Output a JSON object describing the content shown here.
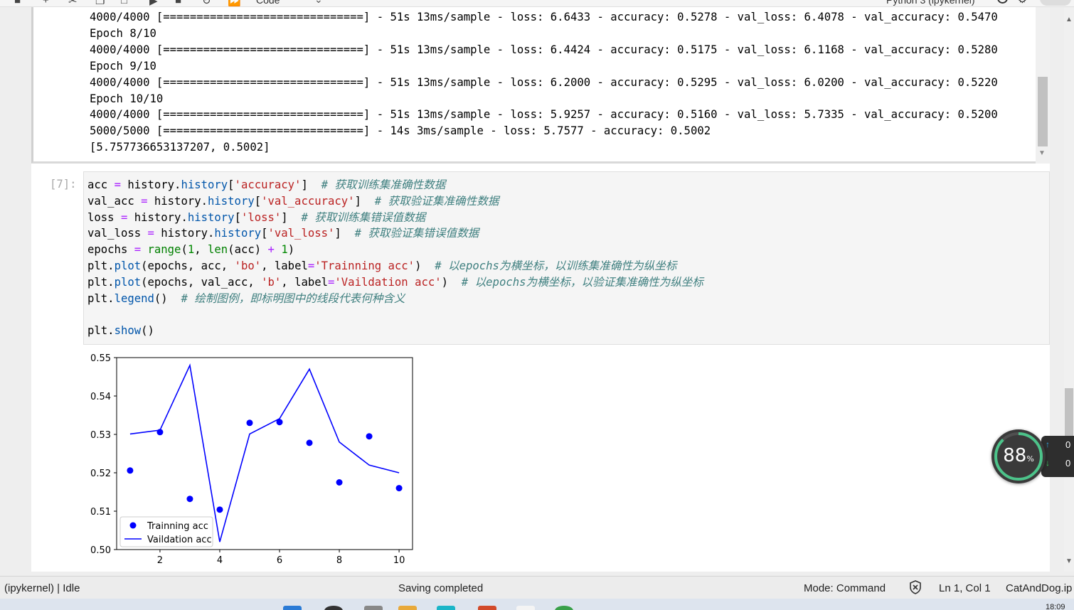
{
  "toolbar": {
    "cell_type": "Code",
    "kernel_name": "Python 3 (ipykernel)"
  },
  "output": {
    "lines": [
      "4000/4000 [==============================] - 51s 13ms/sample - loss: 6.6433 - accuracy: 0.5278 - val_loss: 6.4078 - val_accuracy: 0.5470",
      "Epoch 8/10",
      "4000/4000 [==============================] - 51s 13ms/sample - loss: 6.4424 - accuracy: 0.5175 - val_loss: 6.1168 - val_accuracy: 0.5280",
      "Epoch 9/10",
      "4000/4000 [==============================] - 51s 13ms/sample - loss: 6.2000 - accuracy: 0.5295 - val_loss: 6.0200 - val_accuracy: 0.5220",
      "Epoch 10/10",
      "4000/4000 [==============================] - 51s 13ms/sample - loss: 5.9257 - accuracy: 0.5160 - val_loss: 5.7335 - val_accuracy: 0.5200",
      "5000/5000 [==============================] - 14s 3ms/sample - loss: 5.7577 - accuracy: 0.5002",
      "[5.757736653137207, 0.5002]"
    ]
  },
  "cell": {
    "prompt": "[7]:",
    "code": [
      {
        "tokens": [
          [
            "acc ",
            ""
          ],
          [
            "=",
            "op"
          ],
          [
            " history.",
            ""
          ],
          [
            "history",
            "attr"
          ],
          [
            "[",
            ""
          ],
          [
            "'accuracy'",
            "str"
          ],
          [
            "]  ",
            ""
          ],
          [
            "# 获取训练集准确性数据",
            "com"
          ]
        ]
      },
      {
        "tokens": [
          [
            "val_acc ",
            ""
          ],
          [
            "=",
            "op"
          ],
          [
            " history.",
            ""
          ],
          [
            "history",
            "attr"
          ],
          [
            "[",
            ""
          ],
          [
            "'val_accuracy'",
            "str"
          ],
          [
            "]  ",
            ""
          ],
          [
            "# 获取验证集准确性数据",
            "com"
          ]
        ]
      },
      {
        "tokens": [
          [
            "loss ",
            ""
          ],
          [
            "=",
            "op"
          ],
          [
            " history.",
            ""
          ],
          [
            "history",
            "attr"
          ],
          [
            "[",
            ""
          ],
          [
            "'loss'",
            "str"
          ],
          [
            "]  ",
            ""
          ],
          [
            "# 获取训练集错误值数据",
            "com"
          ]
        ]
      },
      {
        "tokens": [
          [
            "val_loss ",
            ""
          ],
          [
            "=",
            "op"
          ],
          [
            " history.",
            ""
          ],
          [
            "history",
            "attr"
          ],
          [
            "[",
            ""
          ],
          [
            "'val_loss'",
            "str"
          ],
          [
            "]  ",
            ""
          ],
          [
            "# 获取验证集错误值数据",
            "com"
          ]
        ]
      },
      {
        "tokens": [
          [
            "epochs ",
            ""
          ],
          [
            "=",
            "op"
          ],
          [
            " ",
            ""
          ],
          [
            "range",
            "builtin"
          ],
          [
            "(",
            ""
          ],
          [
            "1",
            "num"
          ],
          [
            ", ",
            ""
          ],
          [
            "len",
            "builtin"
          ],
          [
            "(acc) ",
            ""
          ],
          [
            "+",
            "op"
          ],
          [
            " ",
            ""
          ],
          [
            "1",
            "num"
          ],
          [
            ")",
            ""
          ]
        ]
      },
      {
        "tokens": [
          [
            "plt.",
            ""
          ],
          [
            "plot",
            "attr"
          ],
          [
            "(epochs, acc, ",
            ""
          ],
          [
            "'bo'",
            "str"
          ],
          [
            ", label",
            ""
          ],
          [
            "=",
            "op"
          ],
          [
            "'Trainning acc'",
            "str"
          ],
          [
            ")  ",
            ""
          ],
          [
            "# 以epochs为横坐标，以训练集准确性为纵坐标",
            "com"
          ]
        ]
      },
      {
        "tokens": [
          [
            "plt.",
            ""
          ],
          [
            "plot",
            "attr"
          ],
          [
            "(epochs, val_acc, ",
            ""
          ],
          [
            "'b'",
            "str"
          ],
          [
            ", label",
            ""
          ],
          [
            "=",
            "op"
          ],
          [
            "'Vaildation acc'",
            "str"
          ],
          [
            ")  ",
            ""
          ],
          [
            "# 以epochs为横坐标，以验证集准确性为纵坐标",
            "com"
          ]
        ]
      },
      {
        "tokens": [
          [
            "plt.",
            ""
          ],
          [
            "legend",
            "attr"
          ],
          [
            "()  ",
            ""
          ],
          [
            "# 绘制图例，即标明图中的线段代表何种含义",
            "com"
          ]
        ]
      },
      {
        "tokens": []
      },
      {
        "tokens": [
          [
            "plt.",
            ""
          ],
          [
            "show",
            "attr"
          ],
          [
            "()",
            ""
          ]
        ]
      }
    ]
  },
  "chart_data": {
    "type": "line",
    "x": [
      1,
      2,
      3,
      4,
      5,
      6,
      7,
      8,
      9,
      10
    ],
    "series": [
      {
        "name": "Trainning acc",
        "style": "points",
        "color": "#0000ff",
        "values": [
          0.5206,
          0.5306,
          0.5132,
          0.5104,
          0.533,
          0.5332,
          0.5278,
          0.5175,
          0.5295,
          0.516
        ]
      },
      {
        "name": "Vaildation acc",
        "style": "line",
        "color": "#0000ff",
        "values": [
          0.5301,
          0.5311,
          0.548,
          0.502,
          0.5301,
          0.5341,
          0.547,
          0.528,
          0.522,
          0.52
        ]
      }
    ],
    "xlim": [
      0.55,
      10.45
    ],
    "ylim": [
      0.5,
      0.55
    ],
    "xticks": [
      "2",
      "4",
      "6",
      "8",
      "10"
    ],
    "yticks": [
      "0.50",
      "0.51",
      "0.52",
      "0.53",
      "0.54",
      "0.55"
    ],
    "legend": "lower-left",
    "grid": false
  },
  "status": {
    "kernel": "(ipykernel) | Idle",
    "message": "Saving completed",
    "mode": "Mode: Command",
    "position": "Ln 1, Col 1",
    "filename": "CatAndDog.ip"
  },
  "widget": {
    "value": "88",
    "unit": "%",
    "up": "0",
    "down": "0"
  },
  "taskbar": {
    "clock": "18:09"
  },
  "colors": {
    "accent": "#0000ff",
    "string": "#ba2121",
    "comment": "#408080",
    "attr": "#0055aa"
  }
}
